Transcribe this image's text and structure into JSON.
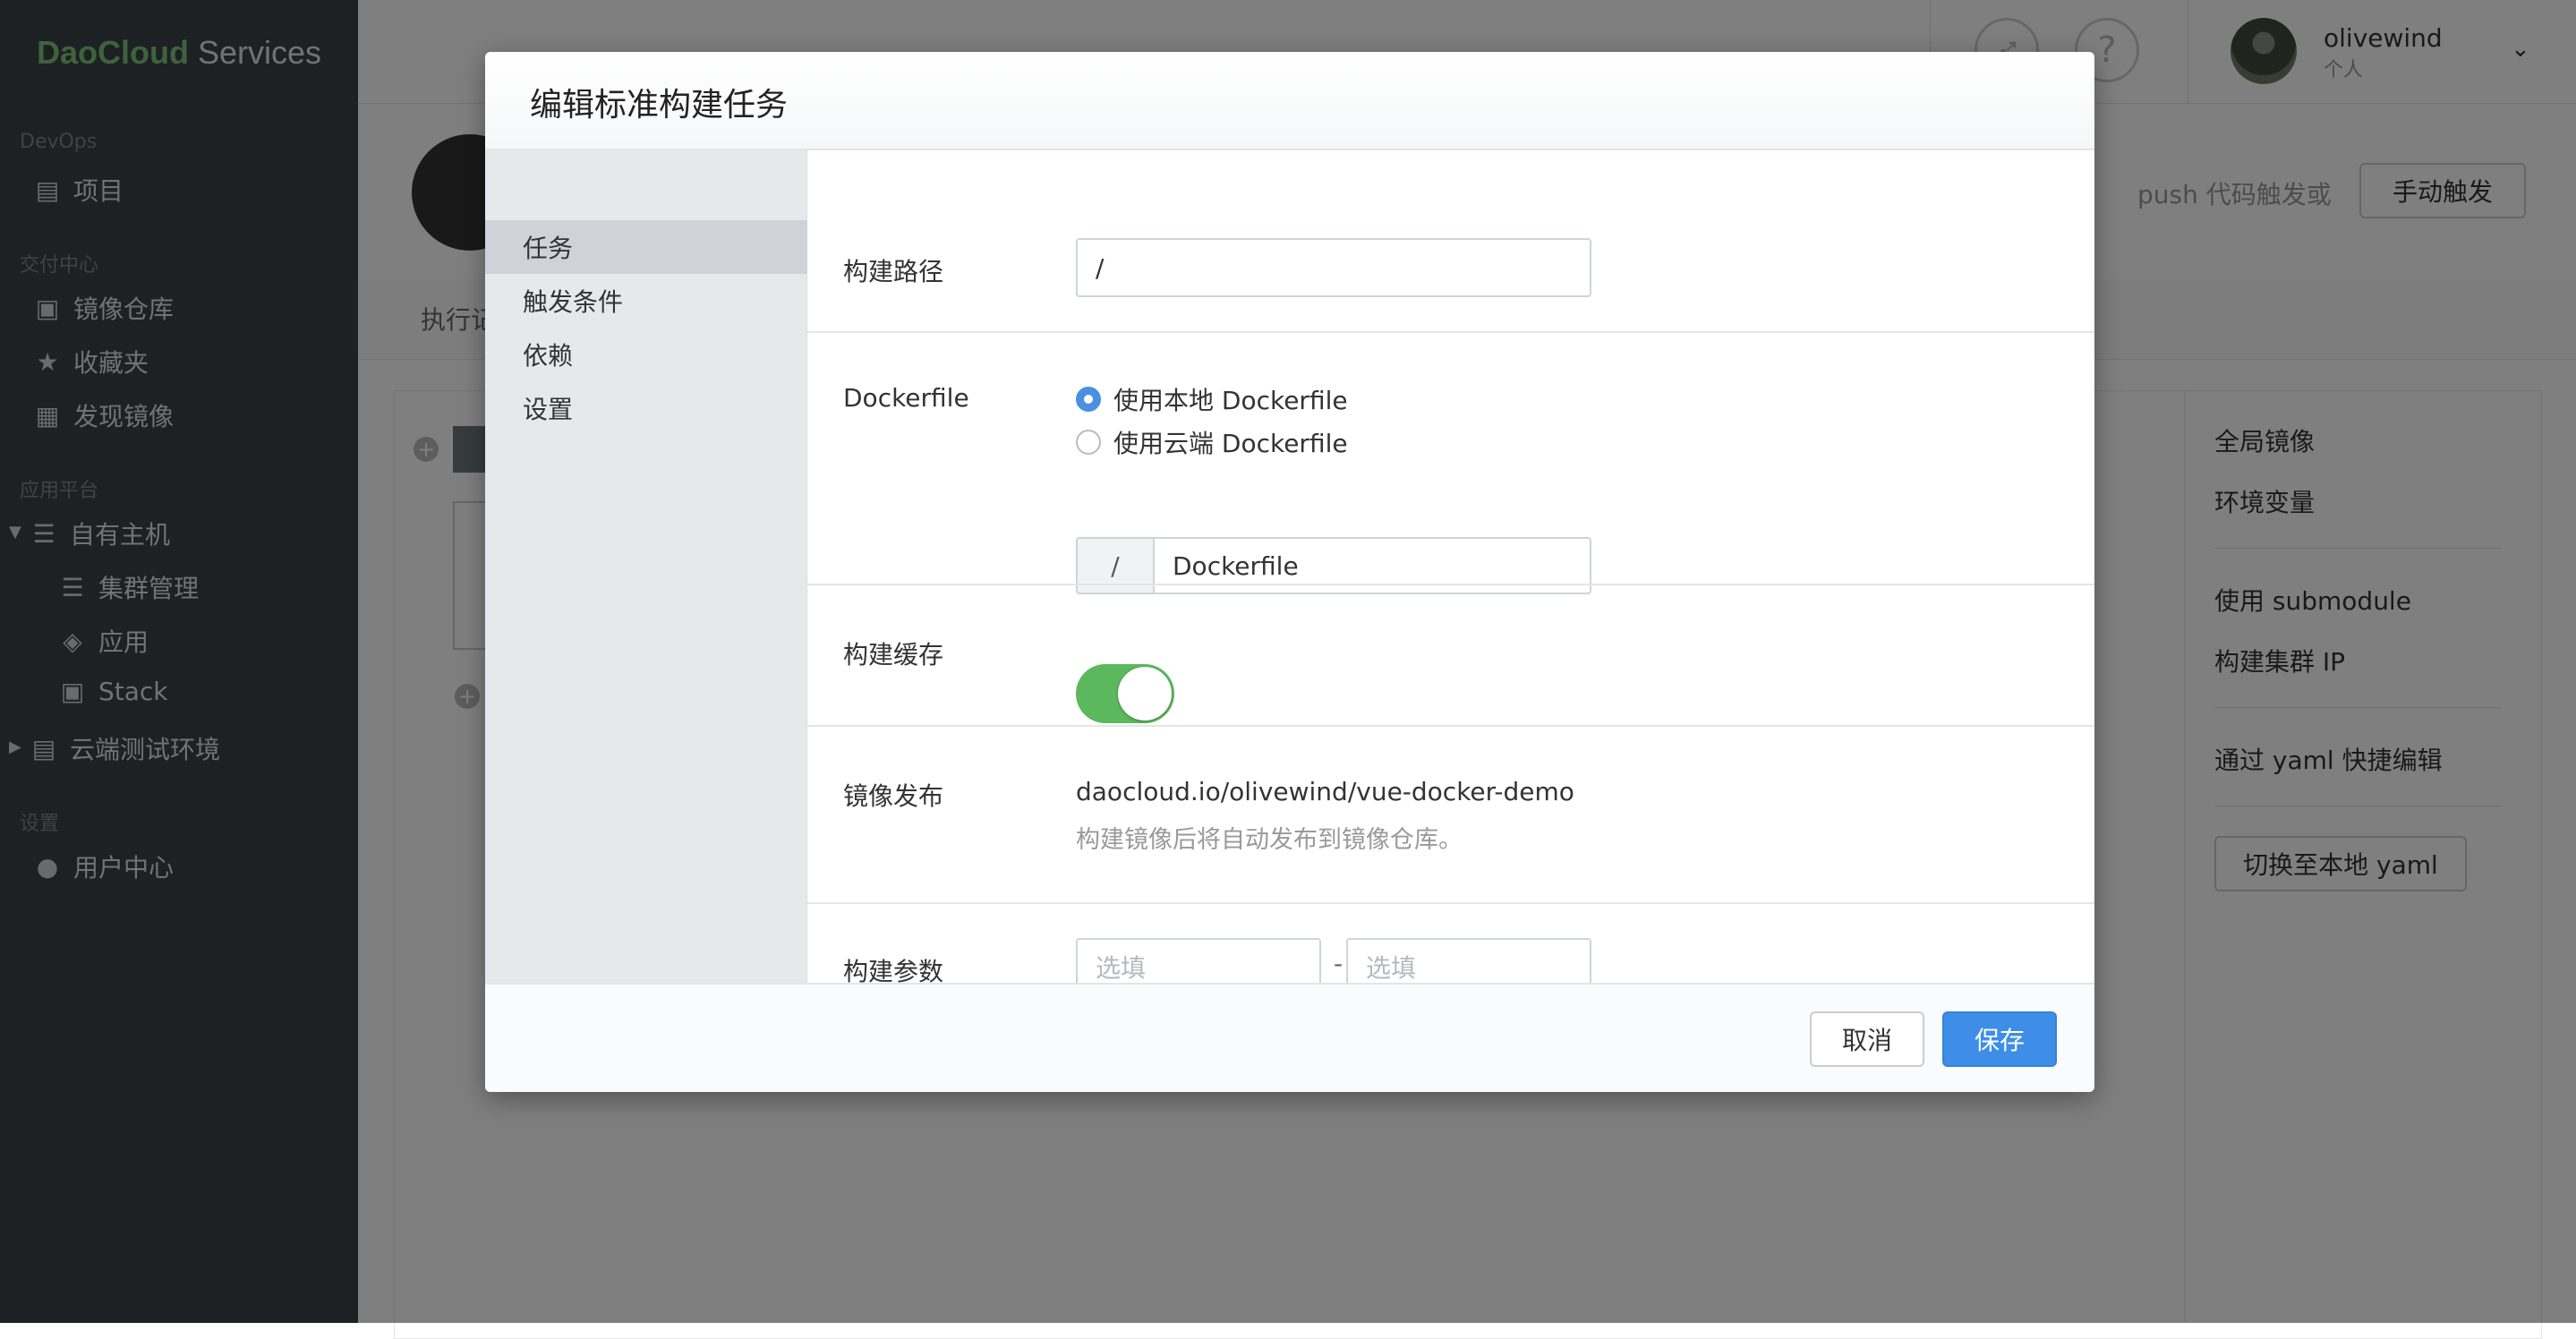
{
  "brand": {
    "part1": "DaoCloud",
    "part2": "Services"
  },
  "sidebar": {
    "sections": [
      {
        "title": "DevOps"
      },
      {
        "title": "交付中心"
      },
      {
        "title": "应用平台"
      },
      {
        "title": "设置"
      }
    ],
    "items": [
      {
        "label": "项目",
        "icon": "project-icon"
      },
      {
        "label": "镜像仓库",
        "icon": "image-repo-icon"
      },
      {
        "label": "收藏夹",
        "icon": "star-icon"
      },
      {
        "label": "发现镜像",
        "icon": "discover-icon"
      },
      {
        "label": "自有主机",
        "icon": "server-icon"
      },
      {
        "label": "集群管理",
        "icon": "cluster-icon"
      },
      {
        "label": "应用",
        "icon": "layers-icon"
      },
      {
        "label": "Stack",
        "icon": "stack-icon"
      },
      {
        "label": "云端测试环境",
        "icon": "clipboard-icon"
      },
      {
        "label": "用户中心",
        "icon": "user-icon"
      }
    ]
  },
  "header": {
    "user_name": "olivewind",
    "user_type": "个人"
  },
  "page": {
    "trigger_text": "push 代码触发或",
    "manual_trigger": "手动触发",
    "subnav_first": "执行记"
  },
  "right_panel": {
    "items": [
      "全局镜像",
      "环境变量",
      "使用 submodule",
      "构建集群 IP",
      "通过 yaml 快捷编辑"
    ],
    "switch_button": "切换至本地 yaml"
  },
  "modal": {
    "title": "编辑标准构建任务",
    "nav": [
      "任务",
      "触发条件",
      "依赖",
      "设置"
    ],
    "build_path": {
      "label": "构建路径",
      "value": "/"
    },
    "dockerfile": {
      "label": "Dockerfile",
      "option_local": "使用本地 Dockerfile",
      "option_cloud": "使用云端 Dockerfile",
      "path_prefix": "/",
      "path_value": "Dockerfile"
    },
    "build_cache": {
      "label": "构建缓存",
      "enabled": true,
      "accent": "#5cb85c"
    },
    "image_publish": {
      "label": "镜像发布",
      "value": "daocloud.io/olivewind/vue-docker-demo",
      "hint": "构建镜像后将自动发布到镜像仓库。"
    },
    "build_args": {
      "label": "构建参数",
      "placeholder_key": "选填",
      "placeholder_value": "选填",
      "separator": "-"
    },
    "cancel": "取消",
    "save": "保存",
    "primary_color": "#3e8ee8"
  }
}
